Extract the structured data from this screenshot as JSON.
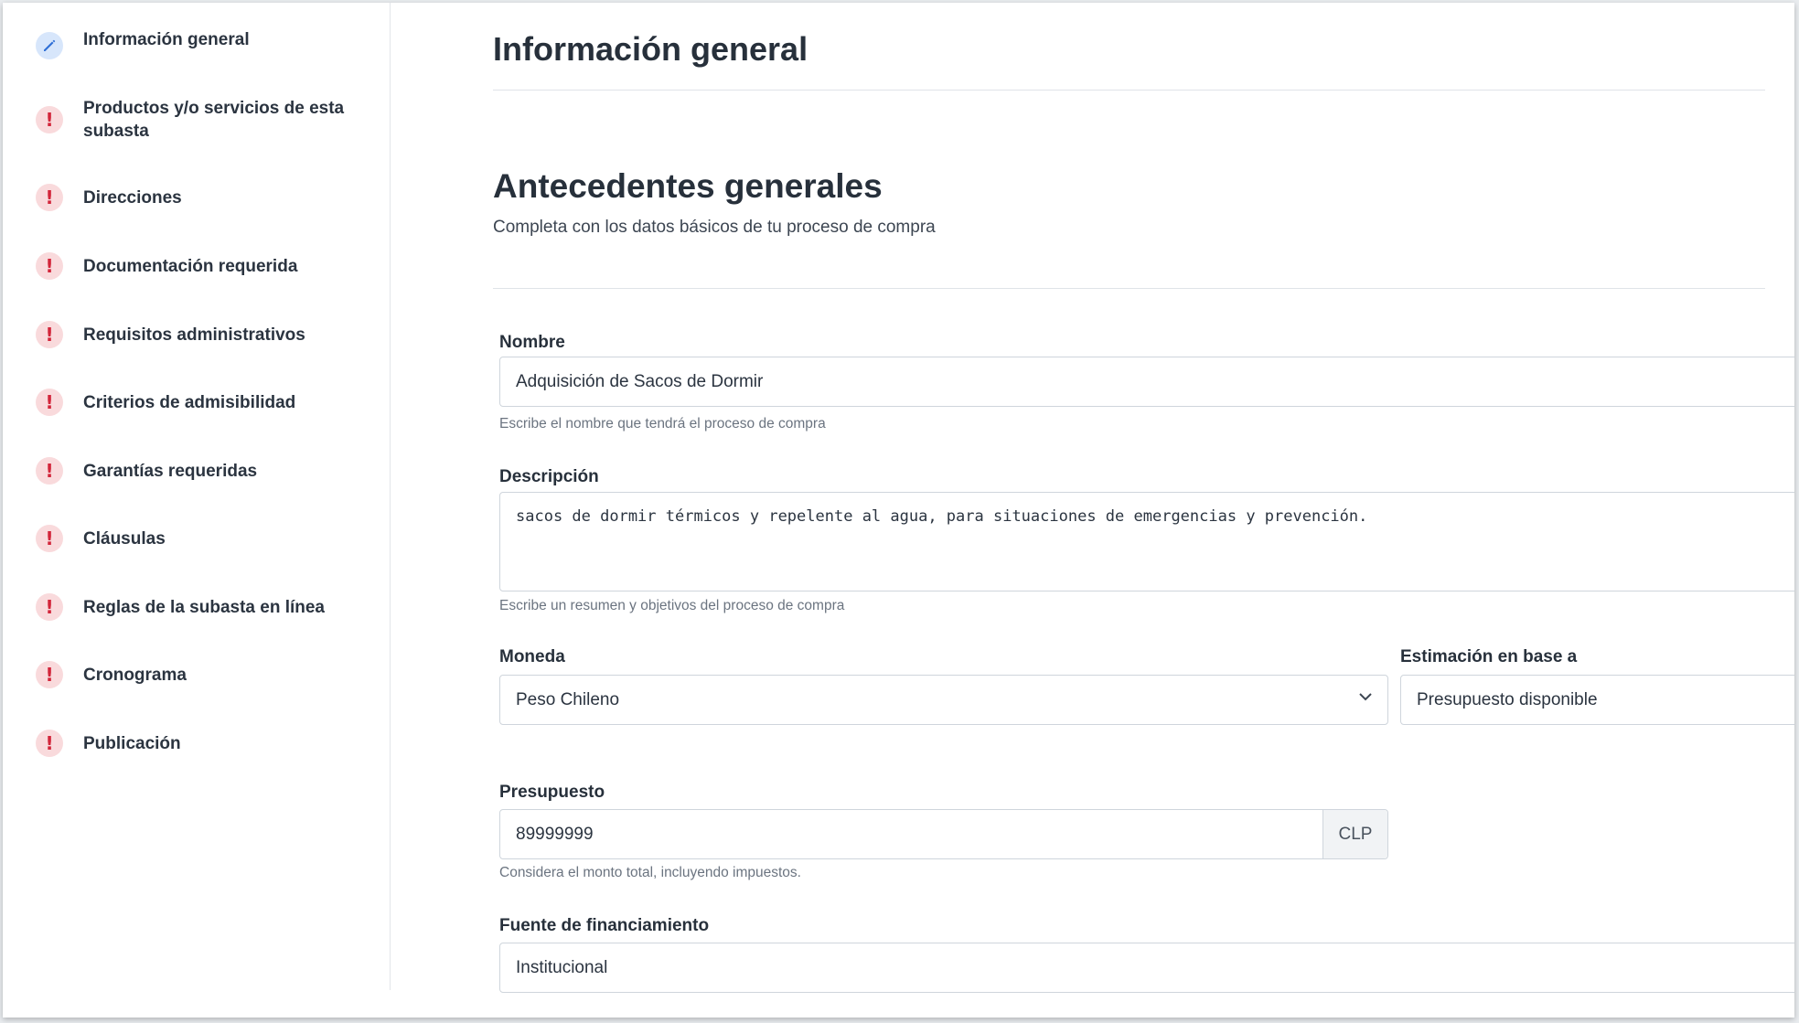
{
  "sidebar": {
    "items": [
      {
        "label": "Información general",
        "status": "edit"
      },
      {
        "label": "Productos y/o servicios de esta subasta",
        "status": "warning"
      },
      {
        "label": "Direcciones",
        "status": "warning"
      },
      {
        "label": "Documentación requerida",
        "status": "warning"
      },
      {
        "label": "Requisitos administrativos",
        "status": "warning"
      },
      {
        "label": "Criterios de admisibilidad",
        "status": "warning"
      },
      {
        "label": "Garantías requeridas",
        "status": "warning"
      },
      {
        "label": "Cláusulas",
        "status": "warning"
      },
      {
        "label": "Reglas de la subasta en línea",
        "status": "warning"
      },
      {
        "label": "Cronograma",
        "status": "warning"
      },
      {
        "label": "Publicación",
        "status": "warning"
      }
    ],
    "warning_glyph": "!"
  },
  "main": {
    "page_title": "Información general",
    "section_title": "Antecedentes generales",
    "section_subtitle": "Completa con los datos básicos de tu proceso de compra",
    "fields": {
      "nombre": {
        "label": "Nombre",
        "value": "Adquisición de Sacos de Dormir",
        "help": "Escribe el nombre que tendrá el proceso de compra"
      },
      "descripcion": {
        "label": "Descripción",
        "value": "sacos de dormir térmicos y repelente al agua, para situaciones de emergencias y prevención.",
        "help": "Escribe un resumen y objetivos del proceso de compra"
      },
      "moneda": {
        "label": "Moneda",
        "value": "Peso Chileno"
      },
      "estimacion": {
        "label": "Estimación en base a",
        "value": "Presupuesto disponible"
      },
      "presupuesto": {
        "label": "Presupuesto",
        "value": "89999999",
        "currency": "CLP",
        "help": "Considera el monto total, incluyendo impuestos."
      },
      "fuente": {
        "label": "Fuente de financiamiento",
        "value": "Institucional"
      }
    }
  },
  "colors": {
    "warning_bg": "#f9dadc",
    "warning_fg": "#d2253a",
    "edit_bg": "#d7e6fb",
    "edit_fg": "#2f6fd6"
  },
  "icons": {
    "edit": "pencil-icon",
    "warning": "exclamation-icon",
    "select": "chevron-down-icon"
  }
}
